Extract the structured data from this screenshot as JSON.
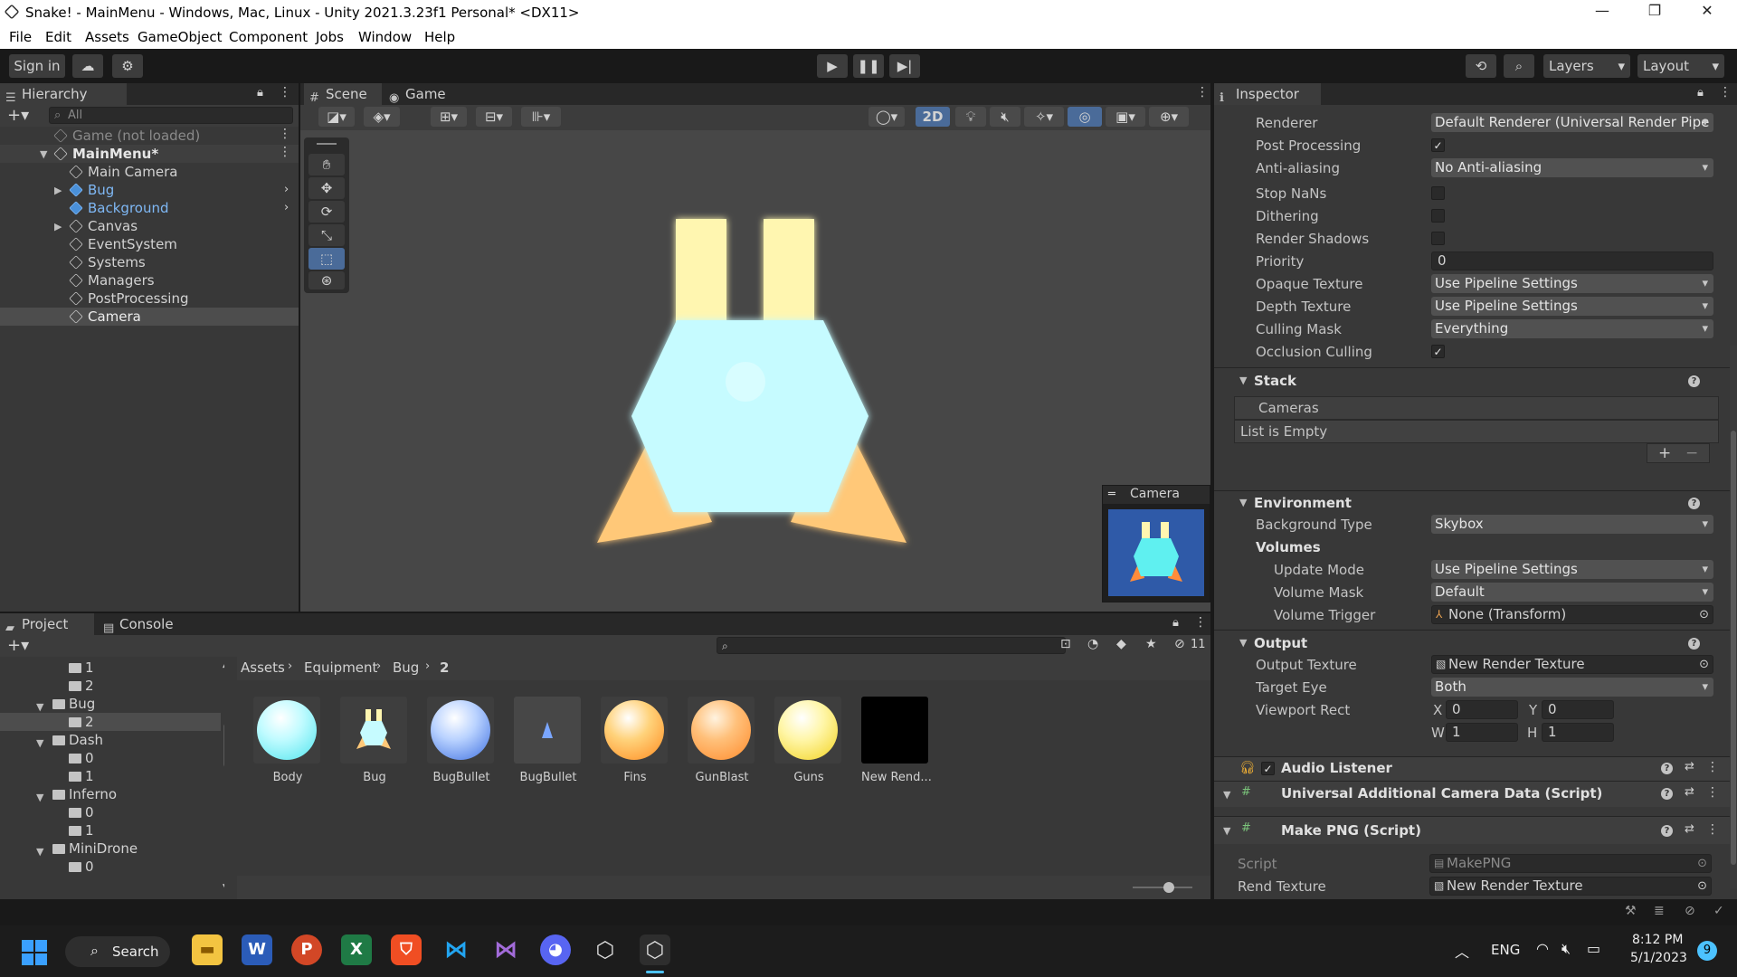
{
  "window": {
    "title": "Snake! - MainMenu - Windows, Mac, Linux - Unity 2021.3.23f1 Personal* <DX11>"
  },
  "menu": [
    "File",
    "Edit",
    "Assets",
    "GameObject",
    "Component",
    "Jobs",
    "Window",
    "Help"
  ],
  "toolbar": {
    "sign_in": "Sign in",
    "layers": "Layers",
    "layout": "Layout"
  },
  "hierarchy": {
    "tab": "Hierarchy",
    "search_placeholder": "All",
    "items": [
      {
        "label": "Game (not loaded)"
      },
      {
        "label": "MainMenu*"
      },
      {
        "label": "Main Camera"
      },
      {
        "label": "Bug"
      },
      {
        "label": "Background"
      },
      {
        "label": "Canvas"
      },
      {
        "label": "EventSystem"
      },
      {
        "label": "Systems"
      },
      {
        "label": "Managers"
      },
      {
        "label": "PostProcessing"
      },
      {
        "label": "Camera"
      }
    ]
  },
  "scene": {
    "tab_scene": "Scene",
    "tab_game": "Game",
    "mode_2d": "2D",
    "preview_title": "Camera"
  },
  "inspector": {
    "tab": "Inspector",
    "renderer_label": "Renderer",
    "renderer_value": "Default Renderer (Universal Render Pipe",
    "post_processing_label": "Post Processing",
    "antialiasing_label": "Anti-aliasing",
    "antialiasing_value": "No Anti-aliasing",
    "stop_nans_label": "Stop NaNs",
    "dithering_label": "Dithering",
    "render_shadows_label": "Render Shadows",
    "priority_label": "Priority",
    "priority_value": "0",
    "opaque_label": "Opaque Texture",
    "opaque_value": "Use Pipeline Settings",
    "depth_label": "Depth Texture",
    "depth_value": "Use Pipeline Settings",
    "culling_label": "Culling Mask",
    "culling_value": "Everything",
    "occlusion_label": "Occlusion Culling",
    "stack_title": "Stack",
    "cameras_label": "Cameras",
    "list_empty": "List is Empty",
    "env_title": "Environment",
    "bg_type_label": "Background Type",
    "bg_type_value": "Skybox",
    "volumes_label": "Volumes",
    "update_mode_label": "Update Mode",
    "update_mode_value": "Use Pipeline Settings",
    "volume_mask_label": "Volume Mask",
    "volume_mask_value": "Default",
    "volume_trigger_label": "Volume Trigger",
    "volume_trigger_value": "None (Transform)",
    "output_title": "Output",
    "output_texture_label": "Output Texture",
    "output_texture_value": "New Render Texture",
    "target_eye_label": "Target Eye",
    "target_eye_value": "Both",
    "viewport_label": "Viewport Rect",
    "vx_label": "X",
    "vx": "0",
    "vy_label": "Y",
    "vy": "0",
    "vw_label": "W",
    "vw": "1",
    "vh_label": "H",
    "vh": "1",
    "audio_listener": "Audio Listener",
    "uacd": "Universal Additional Camera Data (Script)",
    "makepng": "Make PNG (Script)",
    "script_label": "Script",
    "script_value": "MakePNG",
    "rend_texture_label": "Rend Texture",
    "rend_texture_value": "New Render Texture"
  },
  "project": {
    "tab_project": "Project",
    "tab_console": "Console",
    "hidden_count": "11",
    "breadcrumb": [
      "Assets",
      "Equipment",
      "Bug",
      "2"
    ],
    "tree": [
      {
        "label": "1"
      },
      {
        "label": "2"
      },
      {
        "label": "Bug"
      },
      {
        "label": "2"
      },
      {
        "label": "Dash"
      },
      {
        "label": "0"
      },
      {
        "label": "1"
      },
      {
        "label": "Inferno"
      },
      {
        "label": "0"
      },
      {
        "label": "1"
      },
      {
        "label": "MiniDrone"
      },
      {
        "label": "0"
      }
    ],
    "assets": [
      {
        "name": "Body"
      },
      {
        "name": "Bug"
      },
      {
        "name": "BugBullet"
      },
      {
        "name": "BugBullet"
      },
      {
        "name": "Fins"
      },
      {
        "name": "GunBlast"
      },
      {
        "name": "Guns"
      },
      {
        "name": "New Rend..."
      }
    ]
  },
  "taskbar": {
    "search": "Search",
    "lang": "ENG",
    "time": "8:12 PM",
    "date": "5/1/2023",
    "badge": "9"
  }
}
